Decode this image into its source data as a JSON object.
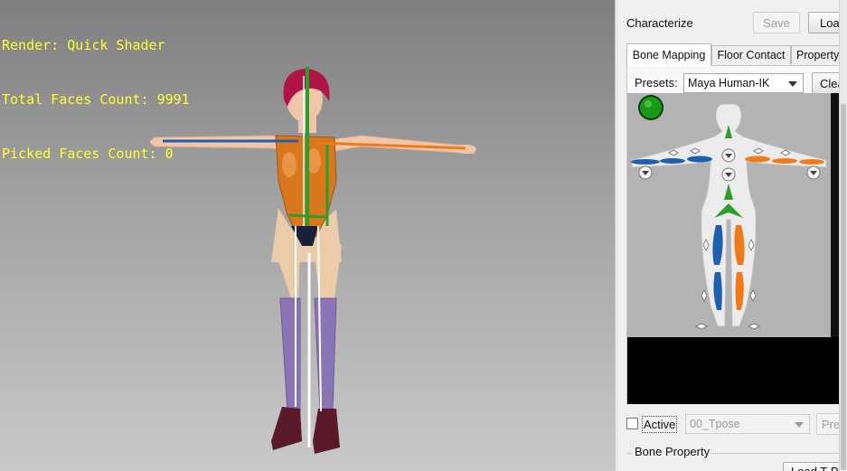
{
  "viewport": {
    "overlay": {
      "render": "Render: Quick Shader",
      "total_faces": "Total Faces Count: 9991",
      "picked_faces": "Picked Faces Count: 0"
    }
  },
  "panel": {
    "title": "Characterize",
    "save_label": "Save",
    "load_label": "Load",
    "tabs": [
      {
        "label": "Bone Mapping",
        "active": true
      },
      {
        "label": "Floor Contact",
        "active": false
      },
      {
        "label": "Property",
        "active": false
      }
    ],
    "presets_label": "Presets:",
    "preset_value": "Maya Human-IK",
    "clear_label": "Clear",
    "active_label": "Active",
    "active_checked": false,
    "pose_value": "00_Tpose",
    "preview_label": "Preview",
    "bone_property_label": "Bone Property",
    "load_tpose_label": "Load T-Pose",
    "status_color": "#1a9a1a"
  },
  "colors": {
    "left_side": "#1f5fb0",
    "right_side": "#f07a1a",
    "center": "#2c9c2c"
  }
}
